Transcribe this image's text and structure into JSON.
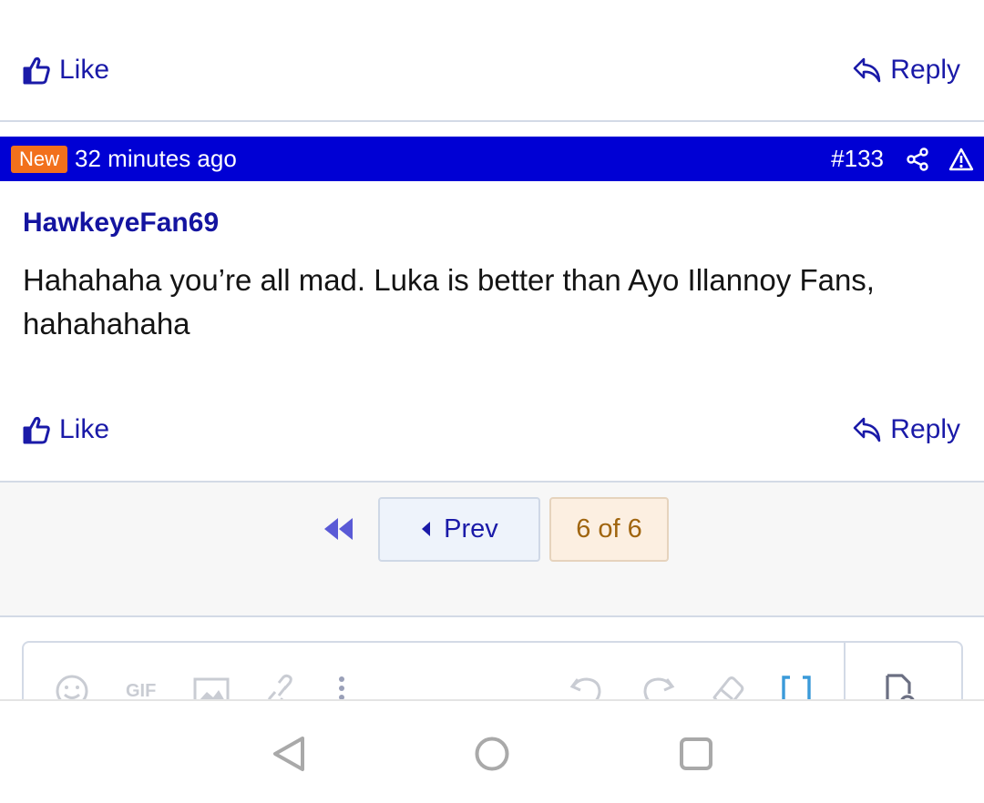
{
  "top_actions": {
    "like_label": "Like",
    "reply_label": "Reply"
  },
  "post": {
    "badge": "New",
    "time": "32 minutes ago",
    "number": "#133",
    "username": "HawkeyeFan69",
    "body": "Hahahaha you’re all mad. Luka is better than Ayo Illannoy Fans, hahahahaha",
    "like_label": "Like",
    "reply_label": "Reply"
  },
  "pagination": {
    "prev_label": "Prev",
    "current_label": "6 of 6"
  },
  "editor_toolbar": {
    "gif_label": "GIF"
  },
  "colors": {
    "accent": "#1a1aa8",
    "header_bg": "#0000d4",
    "badge_bg": "#f2701c",
    "page_current_text": "#a0650f"
  },
  "icons": [
    "thumbs-up-icon",
    "reply-icon",
    "share-icon",
    "warning-icon",
    "first-page-icon",
    "caret-left-icon",
    "smiley-icon",
    "image-icon",
    "link-icon",
    "more-vertical-icon",
    "undo-icon",
    "redo-icon",
    "eraser-icon",
    "bbcode-icon",
    "preview-icon",
    "back-nav-icon",
    "home-nav-icon",
    "recents-nav-icon"
  ]
}
